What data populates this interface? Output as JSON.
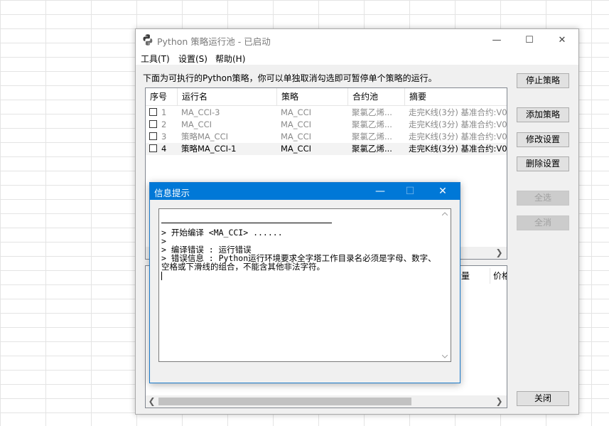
{
  "window": {
    "title": "Python 策略运行池 - 已启动",
    "controls": {
      "minimize": "—",
      "maximize": "☐",
      "close": "✕"
    }
  },
  "menu": [
    "工具(T)",
    "设置(S)",
    "帮助(H)"
  ],
  "instruction": "下面为可执行的Python策略，你可以单独取消勾选即可暂停单个策略的运行。",
  "strategy_table": {
    "columns": [
      "序号",
      "运行名",
      "策略",
      "合约池",
      "摘要"
    ],
    "rows": [
      {
        "index": "1",
        "run_name": "MA_CCI-3",
        "strategy": "MA_CCI",
        "pool": "聚氯乙烯...",
        "summary": "走完K线(3分) 基准合约:V0",
        "state": "disabled"
      },
      {
        "index": "2",
        "run_name": "MA_CCI",
        "strategy": "MA_CCI",
        "pool": "聚氯乙烯...",
        "summary": "走完K线(3分) 基准合约:V0",
        "state": "disabled"
      },
      {
        "index": "3",
        "run_name": "策略MA_CCI",
        "strategy": "MA_CCI",
        "pool": "聚氯乙烯...",
        "summary": "走完K线(3分) 基准合约:V0",
        "state": "disabled"
      },
      {
        "index": "4",
        "run_name": "策略MA_CCI-1",
        "strategy": "MA_CCI",
        "pool": "聚氯乙烯...",
        "summary": "走完K线(3分) 基准合约:V0",
        "state": "active"
      }
    ]
  },
  "second_table": {
    "visible_headers": [
      "量",
      "价格"
    ]
  },
  "buttons": {
    "stop": "停止策略",
    "add": "添加策略",
    "edit": "修改设置",
    "delete": "删除设置",
    "select_all": "全选",
    "deselect_all": "全消",
    "close": "关闭"
  },
  "dialog": {
    "title": "信息提示",
    "log_lines": [
      "> 开始编译 <MA_CCI> ......",
      ">",
      "> 编译错误 : 运行错误",
      "> 错误信息 : Python运行环境要求全字塔工作目录名必须是字母、数字、",
      "空格或下滑线的组合，不能含其他非法字符。"
    ]
  },
  "colors": {
    "accent": "#0078d7",
    "window_bg": "#f0f0f0",
    "disabled_text": "#8a8a8a"
  }
}
